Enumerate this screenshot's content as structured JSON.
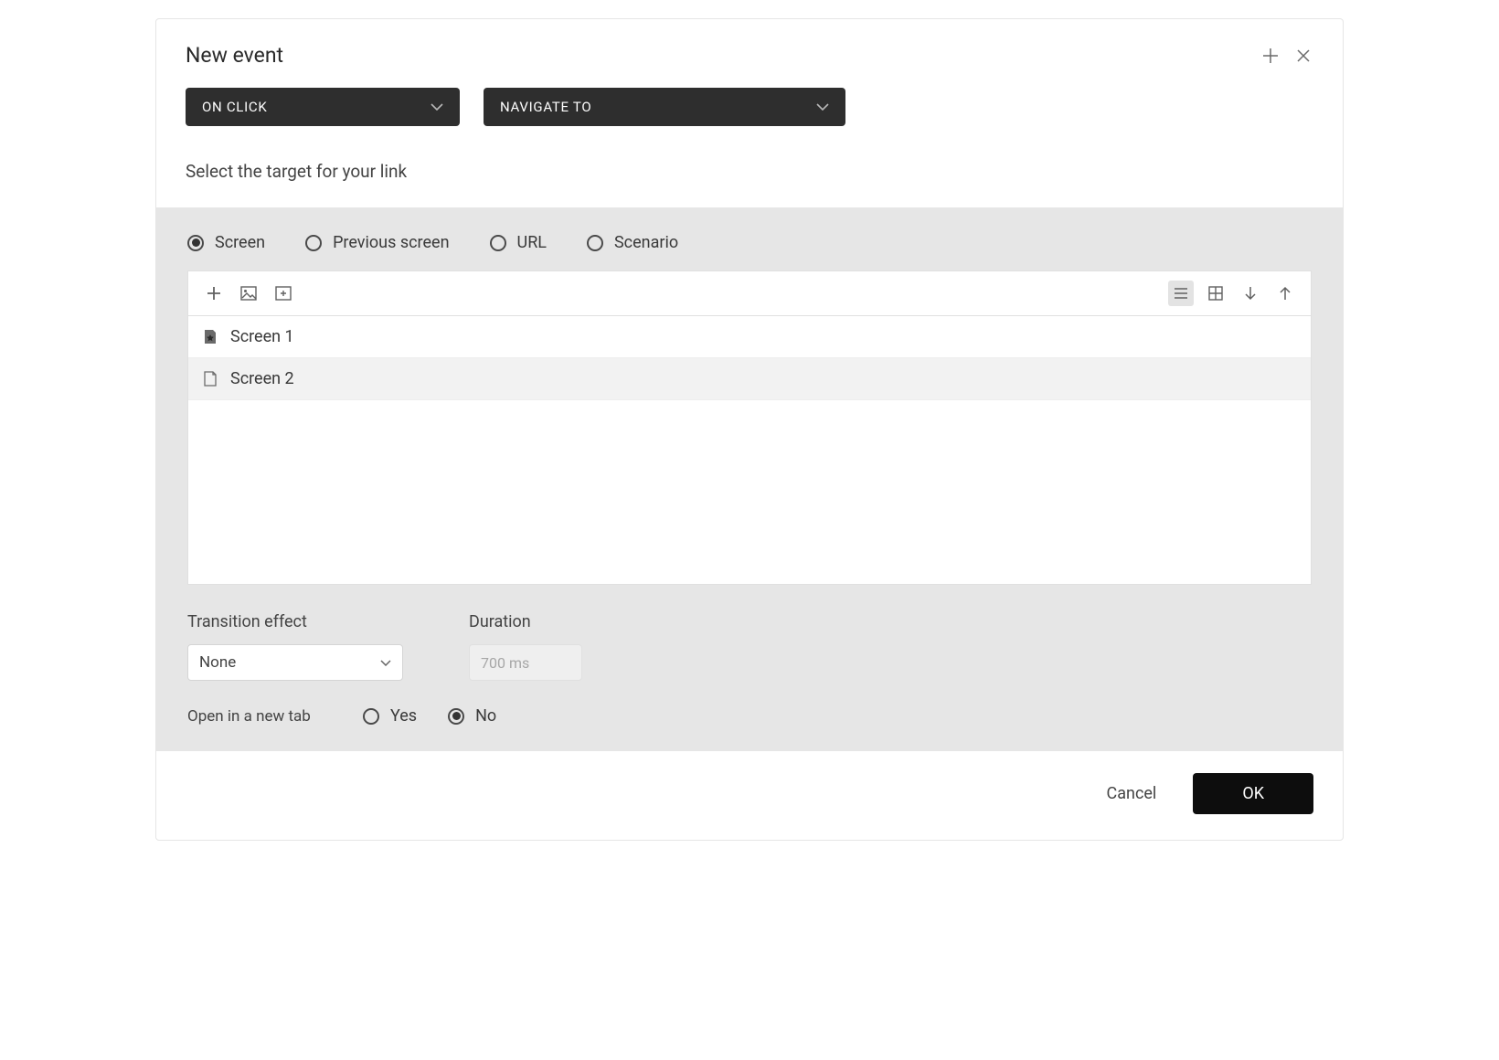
{
  "header": {
    "title": "New event"
  },
  "selectors": {
    "trigger_label": "ON CLICK",
    "action_label": "NAVIGATE TO"
  },
  "subtitle": "Select the target for your link",
  "target_radios": {
    "items": [
      {
        "label": "Screen"
      },
      {
        "label": "Previous screen"
      },
      {
        "label": "URL"
      },
      {
        "label": "Scenario"
      }
    ],
    "selected_index": 0
  },
  "screens": {
    "items": [
      {
        "label": "Screen 1"
      },
      {
        "label": "Screen 2"
      }
    ]
  },
  "transition": {
    "label": "Transition effect",
    "value": "None"
  },
  "duration": {
    "label": "Duration",
    "placeholder": "700 ms"
  },
  "new_tab": {
    "label": "Open in a new tab",
    "yes_label": "Yes",
    "no_label": "No"
  },
  "footer": {
    "cancel_label": "Cancel",
    "ok_label": "OK"
  }
}
